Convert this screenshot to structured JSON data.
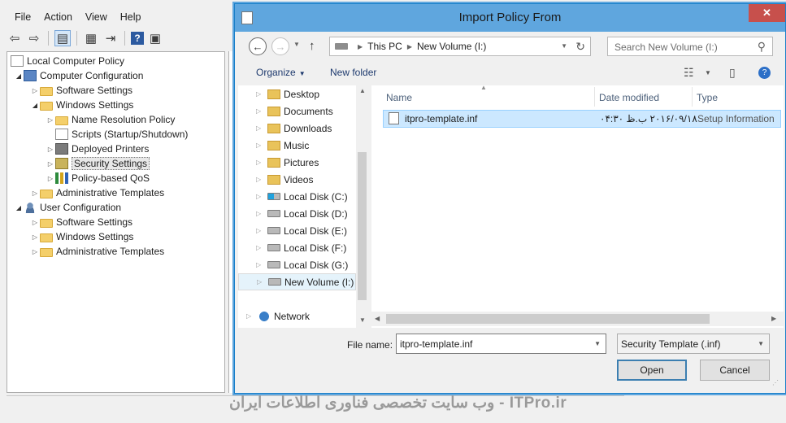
{
  "mmc": {
    "title": "Local Group Policy Editor",
    "menu": [
      "File",
      "Action",
      "View",
      "Help"
    ],
    "toolbar_icons": [
      "back-icon",
      "forward-icon",
      "console-tree-icon",
      "properties-icon",
      "export-list-icon",
      "help-icon",
      "show-hide-icon"
    ],
    "tree": [
      {
        "label": "Local Computer Policy",
        "icon": "policy-icon"
      },
      {
        "label": "Computer Configuration",
        "icon": "computer-icon"
      },
      {
        "label": "Software Settings",
        "icon": "folder-icon"
      },
      {
        "label": "Windows Settings",
        "icon": "folder-icon"
      },
      {
        "label": "Name Resolution Policy",
        "icon": "folder-icon"
      },
      {
        "label": "Scripts (Startup/Shutdown)",
        "icon": "script-icon"
      },
      {
        "label": "Deployed Printers",
        "icon": "printer-icon"
      },
      {
        "label": "Security Settings",
        "icon": "security-icon"
      },
      {
        "label": "Policy-based QoS",
        "icon": "chart-icon"
      },
      {
        "label": "Administrative Templates",
        "icon": "folder-icon"
      },
      {
        "label": "User Configuration",
        "icon": "user-icon"
      },
      {
        "label": "Software Settings",
        "icon": "folder-icon"
      },
      {
        "label": "Windows Settings",
        "icon": "folder-icon"
      },
      {
        "label": "Administrative Templates",
        "icon": "folder-icon"
      }
    ]
  },
  "watermark": "ITPro.ir - وب سایت تخصصی فناوری اطلاعات ایران",
  "dialog": {
    "title": "Import Policy From",
    "close_glyph": "✕",
    "address": {
      "root": "This PC",
      "current": "New Volume (I:)"
    },
    "search_placeholder": "Search New Volume (I:)",
    "organize_label": "Organize",
    "new_folder_label": "New folder",
    "nav_items": [
      {
        "label": "Desktop",
        "icon": "folder-icon"
      },
      {
        "label": "Documents",
        "icon": "folder-icon"
      },
      {
        "label": "Downloads",
        "icon": "folder-icon"
      },
      {
        "label": "Music",
        "icon": "folder-icon"
      },
      {
        "label": "Pictures",
        "icon": "folder-icon"
      },
      {
        "label": "Videos",
        "icon": "folder-icon"
      },
      {
        "label": "Local Disk (C:)",
        "icon": "windows-drive-icon"
      },
      {
        "label": "Local Disk (D:)",
        "icon": "drive-icon"
      },
      {
        "label": "Local Disk (E:)",
        "icon": "drive-icon"
      },
      {
        "label": "Local Disk (F:)",
        "icon": "drive-icon"
      },
      {
        "label": "Local Disk (G:)",
        "icon": "drive-icon"
      },
      {
        "label": "New Volume (I:)",
        "icon": "drive-icon",
        "selected": true
      },
      {
        "label": "Network",
        "icon": "network-icon"
      }
    ],
    "columns": [
      "Name",
      "Date modified",
      "Type"
    ],
    "files": [
      {
        "name": "itpro-template.inf",
        "date": "۲۰۱۶/۰۹/۱۸ ب.ظ ۰۴:۳۰",
        "type": "Setup Information"
      }
    ],
    "filename_label": "File name:",
    "filename_value": "itpro-template.inf",
    "filetype_value": "Security Template (.inf)",
    "open_label": "Open",
    "cancel_label": "Cancel"
  }
}
